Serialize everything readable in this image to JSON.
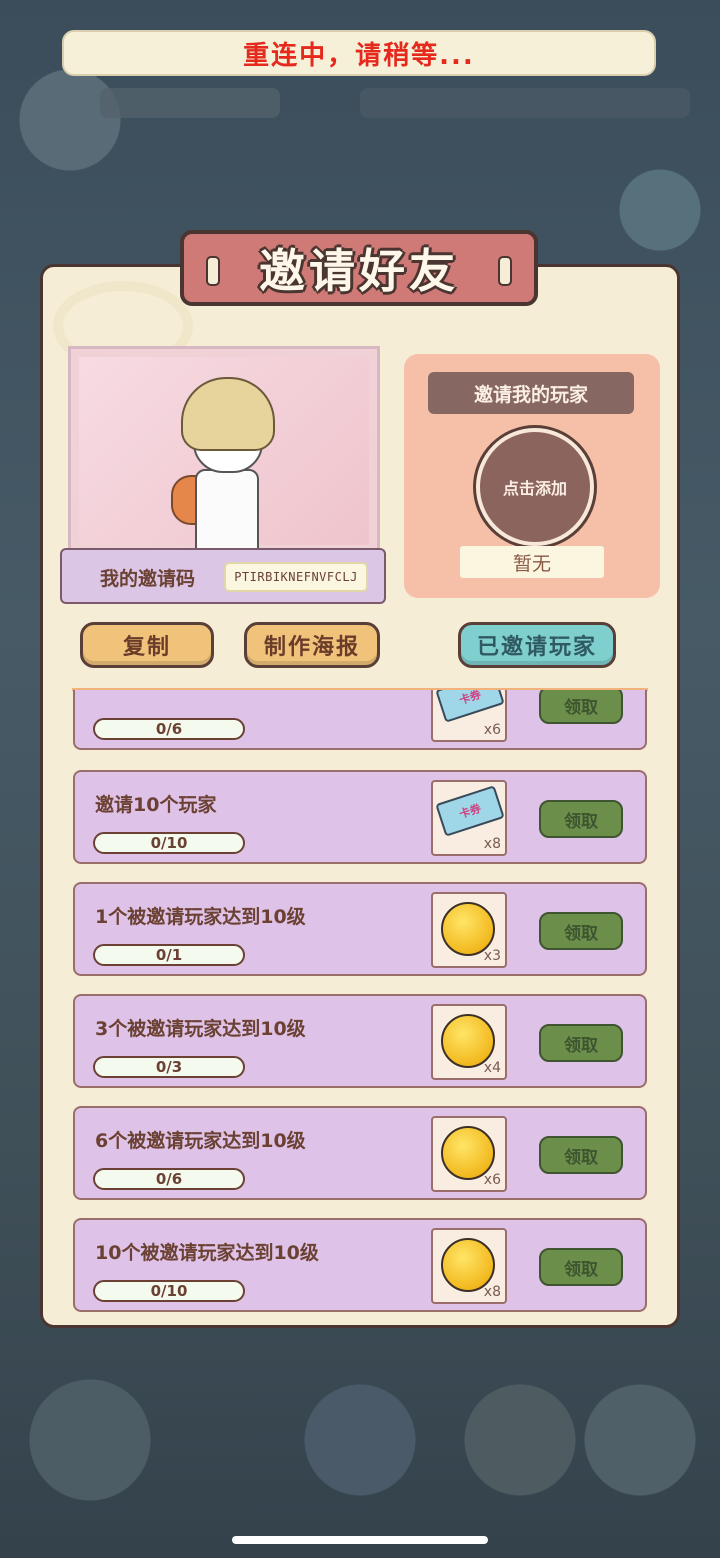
{
  "banner": {
    "text": "重连中，请稍等..."
  },
  "dialog": {
    "title": "邀请好友",
    "my_code_label": "我的邀请码",
    "my_code_value": "PTIRBIKNEFNVFCLJ",
    "inviter": {
      "title": "邀请我的玩家",
      "add_label": "点击添加",
      "none_label": "暂无"
    },
    "buttons": {
      "copy": "复制",
      "poster": "制作海报",
      "invited": "已邀请玩家"
    },
    "tasks": [
      {
        "title": "",
        "progress": "0/6",
        "reward_icon": "ticket-icon",
        "ticket_text": "卡券",
        "count": "x6",
        "claim": "领取"
      },
      {
        "title": "邀请10个玩家",
        "progress": "0/10",
        "reward_icon": "ticket-icon",
        "ticket_text": "卡券",
        "count": "x8",
        "claim": "领取"
      },
      {
        "title": "1个被邀请玩家达到10级",
        "progress": "0/1",
        "reward_icon": "coin-icon",
        "count": "x3",
        "claim": "领取"
      },
      {
        "title": "3个被邀请玩家达到10级",
        "progress": "0/3",
        "reward_icon": "coin-icon",
        "count": "x4",
        "claim": "领取"
      },
      {
        "title": "6个被邀请玩家达到10级",
        "progress": "0/6",
        "reward_icon": "coin-icon",
        "count": "x6",
        "claim": "领取"
      },
      {
        "title": "10个被邀请玩家达到10级",
        "progress": "0/10",
        "reward_icon": "coin-icon",
        "count": "x8",
        "claim": "领取"
      }
    ]
  },
  "colors": {
    "banner_text": "#e52a1d",
    "panel_bg": "#f6edd6",
    "task_bg": "#dec2e7",
    "claim_green": "#6b8e4a",
    "invited_teal": "#7fcfcf"
  }
}
